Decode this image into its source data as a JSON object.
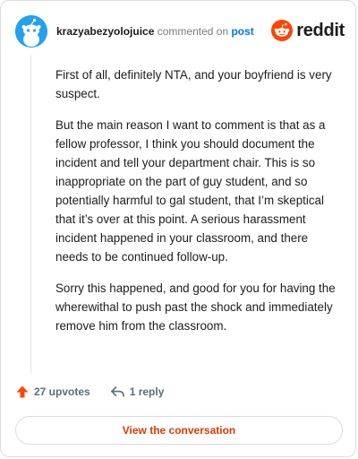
{
  "header": {
    "username": "krazyabezyolojuice",
    "commented_on": "commented on",
    "post_link": "post",
    "brand": "reddit"
  },
  "comment": {
    "paragraphs": [
      "First of all, definitely NTA, and your boyfriend is very suspect.",
      "But the main reason I want to comment is that as a fellow professor, I think you should document the incident and tell your department chair. This is so inappropriate on the part of guy student, and so potentially harmful to gal student, that I’m skeptical that it’s over at this point. A serious harassment incident happened in your classroom, and there needs to be continued follow-up.",
      "Sorry this happened, and good for you for having the wherewithal to push past the shock and immediately remove him from the classroom."
    ]
  },
  "actions": {
    "upvotes": "27 upvotes",
    "replies": "1 reply"
  },
  "footer": {
    "view_conversation": "View the conversation"
  },
  "icons": {
    "upvote": "upvote-arrow-icon",
    "reply": "reply-arrow-icon",
    "avatar": "snoo-avatar-icon",
    "logo": "reddit-logo-icon"
  },
  "colors": {
    "link": "#0079d3",
    "upvote": "#ff4500",
    "cta": "#d93a00",
    "avatar_bg": "#24a0ed"
  }
}
